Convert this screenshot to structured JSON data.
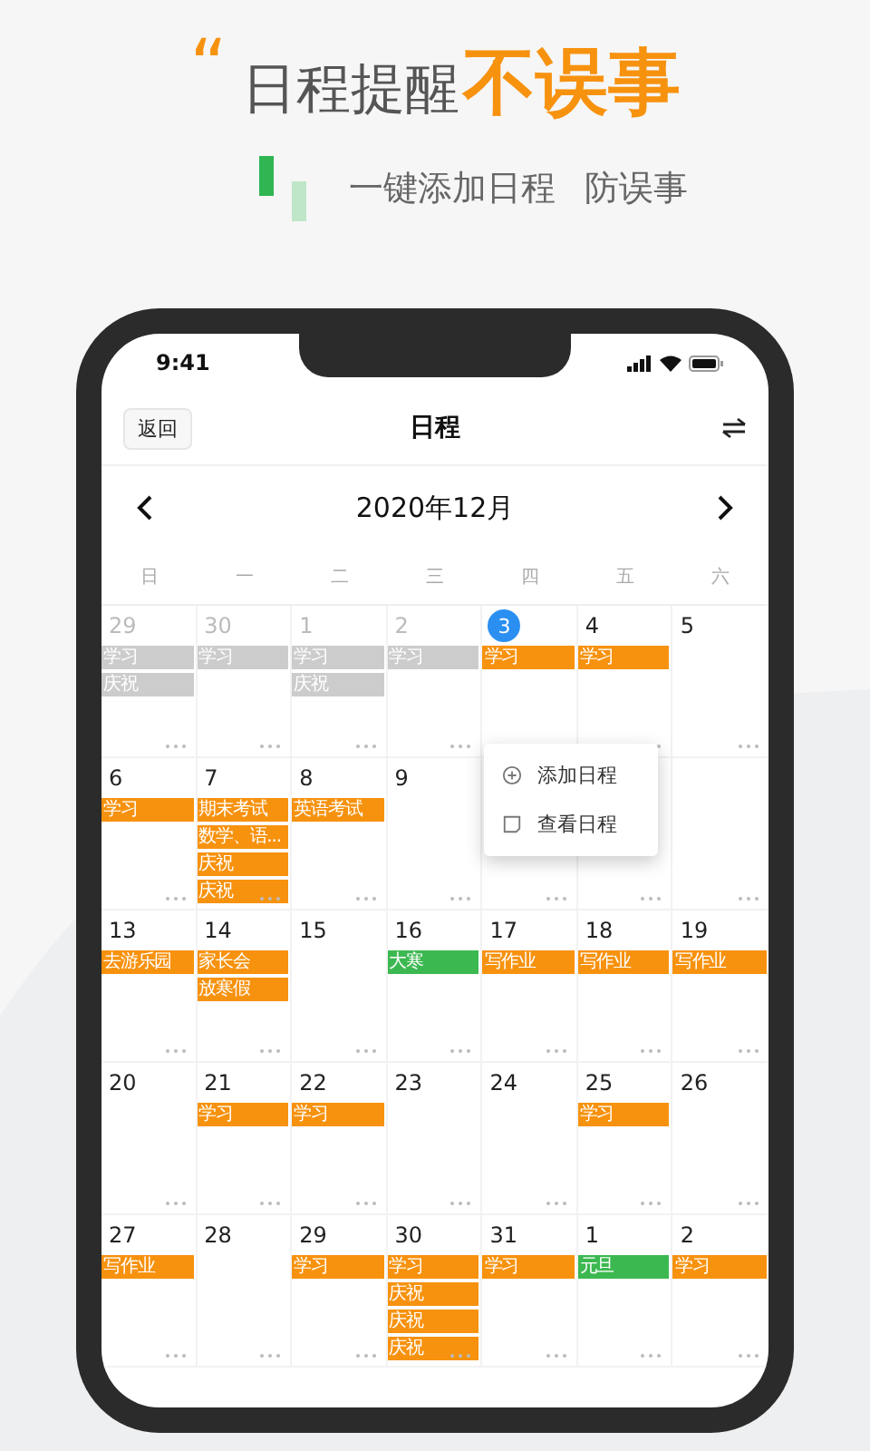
{
  "headline": {
    "quote_mark": "“",
    "lead": "日程提醒",
    "emphasis": "不误事"
  },
  "subtitle": [
    "一键添加日程",
    "防误事"
  ],
  "status_bar": {
    "time": "9:41"
  },
  "nav": {
    "back": "返回",
    "title": "日程"
  },
  "month": "2020年12月",
  "weekdays": [
    "日",
    "一",
    "二",
    "三",
    "四",
    "五",
    "六"
  ],
  "weeks": [
    [
      {
        "day": "29",
        "muted": true,
        "today": false,
        "events": [
          {
            "label": "学习",
            "color": "#cccccc"
          },
          {
            "label": "庆祝",
            "color": "#cccccc"
          }
        ]
      },
      {
        "day": "30",
        "muted": true,
        "today": false,
        "events": [
          {
            "label": "学习",
            "color": "#cccccc"
          }
        ]
      },
      {
        "day": "1",
        "muted": true,
        "today": false,
        "events": [
          {
            "label": "学习",
            "color": "#cccccc"
          },
          {
            "label": "庆祝",
            "color": "#cccccc"
          }
        ]
      },
      {
        "day": "2",
        "muted": true,
        "today": false,
        "events": [
          {
            "label": "学习",
            "color": "#cccccc"
          }
        ]
      },
      {
        "day": "3",
        "muted": false,
        "today": true,
        "events": [
          {
            "label": "学习",
            "color": "#f7920f"
          }
        ]
      },
      {
        "day": "4",
        "muted": false,
        "today": false,
        "events": [
          {
            "label": "学习",
            "color": "#f7920f"
          }
        ]
      },
      {
        "day": "5",
        "muted": false,
        "today": false
      }
    ],
    [
      {
        "day": "6",
        "muted": false,
        "today": false,
        "events": [
          {
            "label": "学习",
            "color": "#f7920f"
          }
        ]
      },
      {
        "day": "7",
        "muted": false,
        "today": false,
        "events": [
          {
            "label": "期末考试",
            "color": "#f7920f"
          },
          {
            "label": "数学、语...",
            "color": "#f7920f"
          },
          {
            "label": "庆祝",
            "color": "#f7920f"
          },
          {
            "label": "庆祝",
            "color": "#f7920f"
          }
        ]
      },
      {
        "day": "8",
        "muted": false,
        "today": false,
        "events": [
          {
            "label": "英语考试",
            "color": "#f7920f"
          }
        ]
      },
      {
        "day": "9",
        "muted": false,
        "today": false
      }
    ],
    [
      {
        "day": "13",
        "muted": false,
        "today": false,
        "events": [
          {
            "label": "去游乐园",
            "color": "#f7920f"
          }
        ]
      },
      {
        "day": "14",
        "muted": false,
        "today": false,
        "events": [
          {
            "label": "家长会",
            "color": "#f7920f"
          },
          {
            "label": "放寒假",
            "color": "#f7920f"
          }
        ]
      },
      {
        "day": "15",
        "muted": false,
        "today": false
      },
      {
        "day": "16",
        "muted": false,
        "today": false,
        "events": [
          {
            "label": "大寒",
            "color": "#3cb850"
          }
        ]
      },
      {
        "day": "17",
        "muted": false,
        "today": false,
        "events": [
          {
            "label": "写作业",
            "color": "#f7920f"
          }
        ]
      },
      {
        "day": "18",
        "muted": false,
        "today": false,
        "events": [
          {
            "label": "写作业",
            "color": "#f7920f"
          }
        ]
      },
      {
        "day": "19",
        "muted": false,
        "today": false,
        "events": [
          {
            "label": "写作业",
            "color": "#f7920f"
          }
        ]
      }
    ],
    [
      {
        "day": "20",
        "muted": false,
        "today": false
      },
      {
        "day": "21",
        "muted": false,
        "today": false,
        "events": [
          {
            "label": "学习",
            "color": "#f7920f"
          }
        ]
      },
      {
        "day": "22",
        "muted": false,
        "today": false,
        "events": [
          {
            "label": "学习",
            "color": "#f7920f"
          }
        ]
      },
      {
        "day": "23",
        "muted": false,
        "today": false
      },
      {
        "day": "24",
        "muted": false,
        "today": false
      },
      {
        "day": "25",
        "muted": false,
        "today": false,
        "events": [
          {
            "label": "学习",
            "color": "#f7920f"
          }
        ]
      },
      {
        "day": "26",
        "muted": false,
        "today": false
      }
    ],
    [
      {
        "day": "27",
        "muted": false,
        "today": false,
        "events": [
          {
            "label": "写作业",
            "color": "#f7920f"
          }
        ]
      },
      {
        "day": "28",
        "muted": false,
        "today": false
      },
      {
        "day": "29",
        "muted": false,
        "today": false,
        "events": [
          {
            "label": "学习",
            "color": "#f7920f"
          }
        ]
      },
      {
        "day": "30",
        "muted": false,
        "today": false,
        "events": [
          {
            "label": "学习",
            "color": "#f7920f"
          },
          {
            "label": "庆祝",
            "color": "#f7920f"
          },
          {
            "label": "庆祝",
            "color": "#f7920f"
          },
          {
            "label": "庆祝",
            "color": "#f7920f"
          }
        ]
      },
      {
        "day": "31",
        "muted": false,
        "today": false,
        "events": [
          {
            "label": "学习",
            "color": "#f7920f"
          }
        ]
      },
      {
        "day": "1",
        "muted": false,
        "today": false,
        "events": [
          {
            "label": "元旦",
            "color": "#3cb850"
          }
        ]
      },
      {
        "day": "2",
        "muted": false,
        "today": false,
        "events": [
          {
            "label": "学习",
            "color": "#f7920f"
          }
        ]
      }
    ]
  ],
  "popup": {
    "items": [
      {
        "kind": "add",
        "label": "添加日程"
      },
      {
        "kind": "view",
        "label": "查看日程"
      }
    ]
  }
}
